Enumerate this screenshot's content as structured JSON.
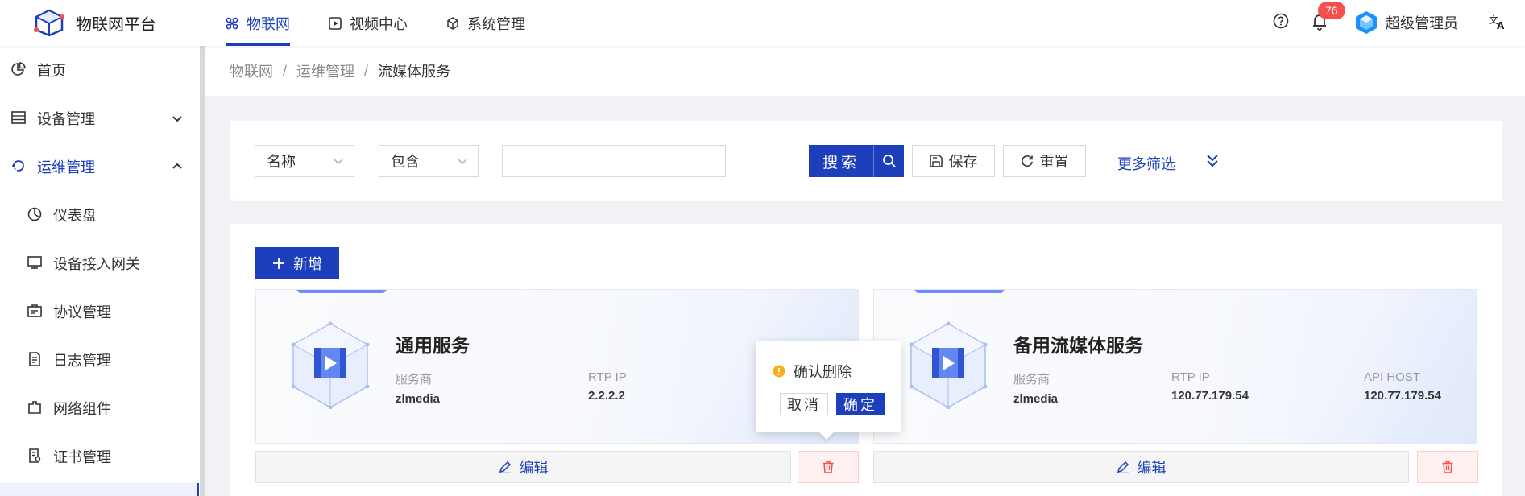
{
  "header": {
    "logo_text": "物联网平台",
    "nav": [
      {
        "label": "物联网",
        "icon": "iot-icon",
        "active": true
      },
      {
        "label": "视频中心",
        "icon": "play-icon",
        "active": false
      },
      {
        "label": "系统管理",
        "icon": "cube-icon",
        "active": false
      }
    ],
    "notification_count": "76",
    "user_name": "超级管理员"
  },
  "sidebar": {
    "items": [
      {
        "label": "首页",
        "icon": "pie-chart-icon"
      },
      {
        "label": "设备管理",
        "icon": "device-list-icon",
        "expanded": false
      },
      {
        "label": "运维管理",
        "icon": "ops-icon",
        "expanded": true,
        "active": true
      },
      {
        "label": "仪表盘",
        "icon": "dashboard-icon"
      },
      {
        "label": "设备接入网关",
        "icon": "monitor-icon"
      },
      {
        "label": "协议管理",
        "icon": "protocol-icon"
      },
      {
        "label": "日志管理",
        "icon": "log-icon"
      },
      {
        "label": "网络组件",
        "icon": "network-icon"
      },
      {
        "label": "证书管理",
        "icon": "certificate-icon"
      }
    ]
  },
  "breadcrumb": [
    "物联网",
    "运维管理",
    "流媒体服务"
  ],
  "filter": {
    "field_select": "名称",
    "operator_select": "包含",
    "search_value": "",
    "search_label": "搜索",
    "save_label": "保存",
    "reset_label": "重置",
    "more_label": "更多筛选"
  },
  "toolbar": {
    "add_label": "新增"
  },
  "services": [
    {
      "name": "通用服务",
      "fields": [
        {
          "key": "服务商",
          "value": "zlmedia"
        },
        {
          "key": "RTP IP",
          "value": "2.2.2.2"
        }
      ],
      "edit_label": "编辑"
    },
    {
      "name": "备用流媒体服务",
      "fields": [
        {
          "key": "服务商",
          "value": "zlmedia"
        },
        {
          "key": "RTP IP",
          "value": "120.77.179.54"
        },
        {
          "key": "API HOST",
          "value": "120.77.179.54"
        }
      ],
      "edit_label": "编辑"
    }
  ],
  "popconfirm": {
    "message": "确认删除",
    "cancel_label": "取消",
    "ok_label": "确定"
  },
  "colors": {
    "primary": "#1d3fbb",
    "danger": "#f5504f",
    "warning": "#faad14"
  }
}
